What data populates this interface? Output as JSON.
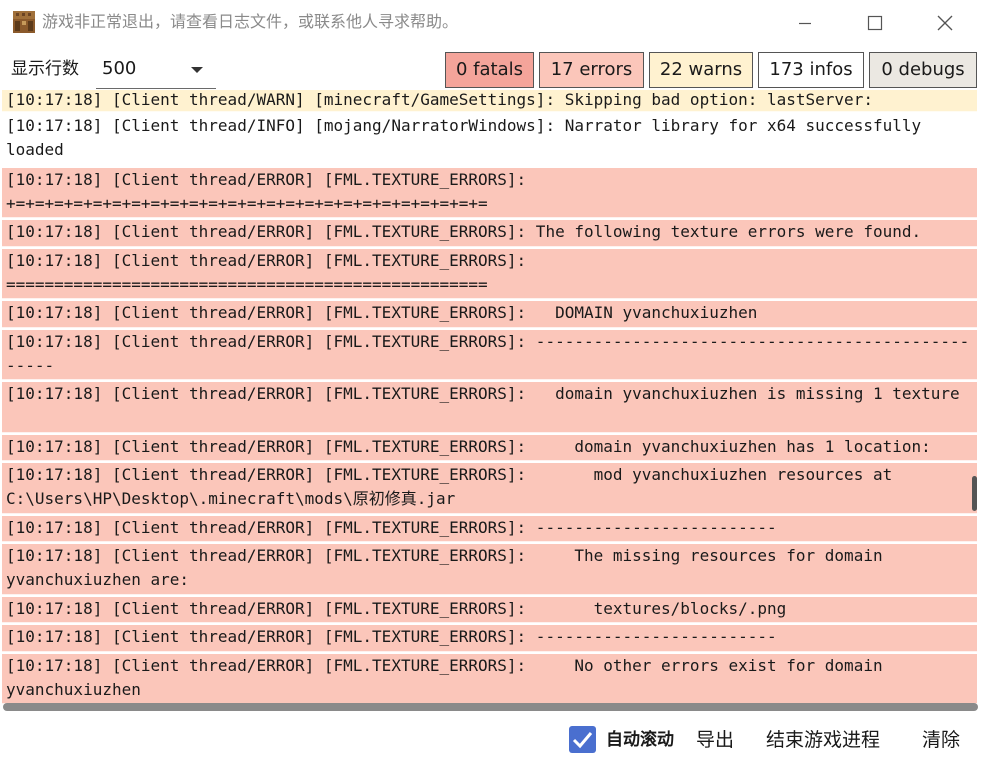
{
  "window": {
    "title": "游戏非正常退出，请查看日志文件，或联系他人寻求帮助。"
  },
  "toolbar": {
    "rows_label": "显示行数",
    "rows_value": "500"
  },
  "filters": {
    "fatals": "0 fatals",
    "errors": "17 errors",
    "warns": "22 warns",
    "infos": "173 infos",
    "debugs": "0 debugs"
  },
  "colors": {
    "fatal_bg": "#f4a49a",
    "error_bg": "#fbc6ba",
    "warn_bg": "#fff2d0",
    "info_bg": "#ffffff",
    "debug_bg": "#ebe8e2",
    "checkbox": "#4a6fcf",
    "scrollbar": "#8a8a8a"
  },
  "log": {
    "lines": [
      {
        "level": "warn",
        "text": "[10:17:18] [Client thread/WARN] [minecraft/GameSettings]: Skipping bad option: lastServer:"
      },
      {
        "level": "info",
        "text": "[10:17:18] [Client thread/INFO] [mojang/NarratorWindows]: Narrator library for x64 successfully loaded"
      },
      {
        "level": "error",
        "text": "[10:17:18] [Client thread/ERROR] [FML.TEXTURE_ERRORS]: +=+=+=+=+=+=+=+=+=+=+=+=+=+=+=+=+=+=+=+=+=+=+=+=+="
      },
      {
        "level": "error",
        "text": "[10:17:18] [Client thread/ERROR] [FML.TEXTURE_ERRORS]: The following texture errors were found."
      },
      {
        "level": "error",
        "text": "[10:17:18] [Client thread/ERROR] [FML.TEXTURE_ERRORS]: =================================================="
      },
      {
        "level": "error",
        "text": "[10:17:18] [Client thread/ERROR] [FML.TEXTURE_ERRORS]:   DOMAIN yvanchuxiuzhen"
      },
      {
        "level": "error",
        "text": "[10:17:18] [Client thread/ERROR] [FML.TEXTURE_ERRORS]: --------------------------------------------------"
      },
      {
        "level": "error",
        "text": "[10:17:18] [Client thread/ERROR] [FML.TEXTURE_ERRORS]:   domain yvanchuxiuzhen is missing 1 texture"
      },
      {
        "level": "error",
        "text": "[10:17:18] [Client thread/ERROR] [FML.TEXTURE_ERRORS]:     domain yvanchuxiuzhen has 1 location:"
      },
      {
        "level": "error",
        "text": "[10:17:18] [Client thread/ERROR] [FML.TEXTURE_ERRORS]:       mod yvanchuxiuzhen resources at C:\\Users\\HP\\Desktop\\.minecraft\\mods\\原初修真.jar"
      },
      {
        "level": "error",
        "text": "[10:17:18] [Client thread/ERROR] [FML.TEXTURE_ERRORS]: -------------------------"
      },
      {
        "level": "error",
        "text": "[10:17:18] [Client thread/ERROR] [FML.TEXTURE_ERRORS]:     The missing resources for domain yvanchuxiuzhen are:"
      },
      {
        "level": "error",
        "text": "[10:17:18] [Client thread/ERROR] [FML.TEXTURE_ERRORS]:       textures/blocks/.png"
      },
      {
        "level": "error",
        "text": "[10:17:18] [Client thread/ERROR] [FML.TEXTURE_ERRORS]: -------------------------"
      },
      {
        "level": "error",
        "text": "[10:17:18] [Client thread/ERROR] [FML.TEXTURE_ERRORS]:     No other errors exist for domain yvanchuxiuzhen"
      }
    ]
  },
  "bottom": {
    "autoscroll_label": "自动滚动",
    "autoscroll_checked": true,
    "export_label": "导出",
    "kill_label": "结束游戏进程",
    "clear_label": "清除"
  }
}
